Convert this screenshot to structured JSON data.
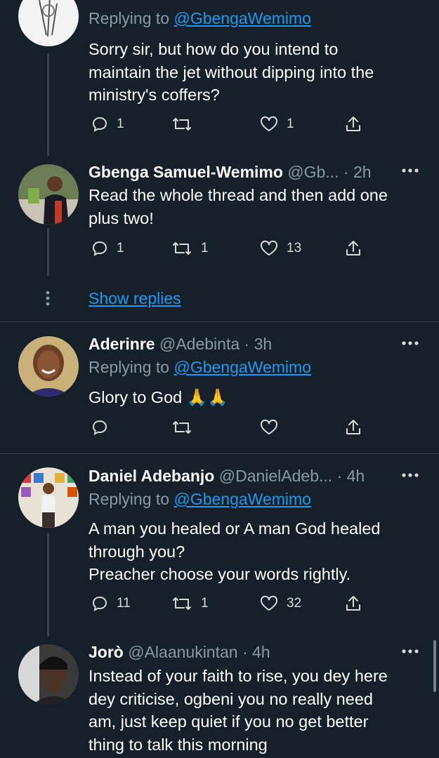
{
  "tweets": [
    {
      "id": "t1",
      "replying_prefix": "Replying to ",
      "replying_handle": "@GbengaWemimo",
      "text": "Sorry sir,  but how do you intend to\nmaintain the jet without dipping into the\nministry's coffers?",
      "replies": "1",
      "retweets": "",
      "likes": "1"
    },
    {
      "id": "t2",
      "name": "Gbenga Samuel-Wemimo",
      "meta": "@Gb... · 2h",
      "text": "Read the whole thread and then add one\nplus two!",
      "replies": "1",
      "retweets": "1",
      "likes": "13"
    },
    {
      "id": "t3",
      "name": "Aderinre",
      "meta": "@Adebinta · 3h",
      "replying_prefix": "Replying to ",
      "replying_handle": "@GbengaWemimo",
      "text": "Glory to God 🙏🙏",
      "replies": "",
      "retweets": "",
      "likes": ""
    },
    {
      "id": "t4",
      "name": "Daniel Adebanjo",
      "meta": "@DanielAdeb... · 4h",
      "replying_prefix": "Replying to ",
      "replying_handle": "@GbengaWemimo",
      "text": "A man you healed or A man God healed\nthrough you?\nPreacher choose your words rightly.",
      "replies": "11",
      "retweets": "1",
      "likes": "32"
    },
    {
      "id": "t5",
      "name": "Jorò",
      "meta": "@Alaanukintan · 4h",
      "text": "Instead of your faith to rise, you dey here\ndey criticise, ogbeni you no really need\nam, just keep quiet if you no get better\nthing to talk this morning"
    }
  ],
  "show_replies_label": "Show replies",
  "icons": {
    "reply": "reply-icon",
    "retweet": "retweet-icon",
    "like": "heart-icon",
    "share": "share-icon",
    "more": "more-icon"
  },
  "colors": {
    "background": "#15202b",
    "link": "#1d9bf0",
    "muted": "#8b98a5",
    "divider": "#38444d"
  }
}
